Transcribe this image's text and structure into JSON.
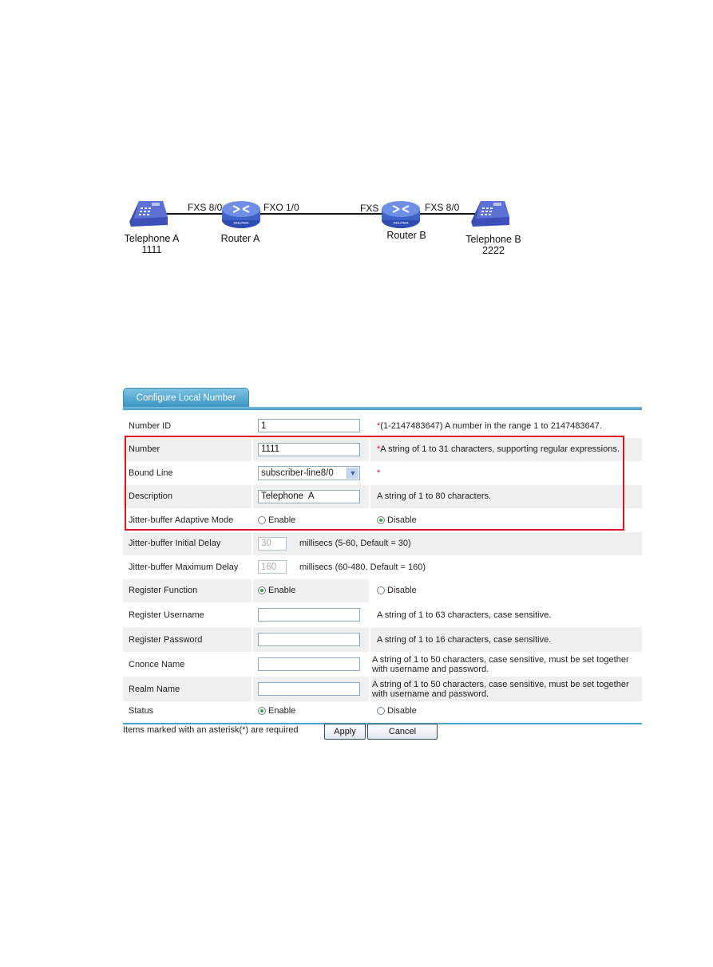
{
  "diagram": {
    "devices": [
      {
        "id": "telephone-a",
        "name": "Telephone A",
        "number": "1111"
      },
      {
        "id": "router-a",
        "name": "Router A",
        "badge": "ROUTER"
      },
      {
        "id": "router-b",
        "name": "Router B",
        "badge": "ROUTER"
      },
      {
        "id": "telephone-b",
        "name": "Telephone B",
        "number": "2222"
      }
    ],
    "ports": {
      "router_a_left": "FXS 8/0",
      "router_a_right": "FXO  1/0",
      "router_b_left": "FXS",
      "router_b_right": "FXS 8/0"
    }
  },
  "form": {
    "tab_label": "Configure Local Number",
    "required_mark": "*",
    "rows": {
      "number_id": {
        "label": "Number ID",
        "value": "1",
        "hint": "(1-2147483647) A number in the range 1 to 2147483647."
      },
      "number": {
        "label": "Number",
        "value": "1111",
        "hint": "A string of 1 to 31 characters, supporting regular expressions."
      },
      "bound_line": {
        "label": "Bound Line",
        "value": "subscriber-line8/0",
        "hint": ""
      },
      "description": {
        "label": "Description",
        "value": "Telephone  A",
        "hint": "A string of 1 to 80 characters."
      },
      "jitter_adaptive": {
        "label": "Jitter-buffer Adaptive Mode",
        "options": [
          "Enable",
          "Disable"
        ],
        "selected": "Disable"
      },
      "jitter_initial": {
        "label": "Jitter-buffer Initial Delay",
        "value": "30",
        "hint": "millisecs (5-60, Default = 30)"
      },
      "jitter_max": {
        "label": "Jitter-buffer Maximum Delay",
        "value": "160",
        "hint": "millisecs (60-480, Default = 160)"
      },
      "register_function": {
        "label": "Register Function",
        "options": [
          "Enable",
          "Disable"
        ],
        "selected": "Enable"
      },
      "register_username": {
        "label": "Register Username",
        "value": "",
        "hint": "A string of 1 to 63 characters, case sensitive."
      },
      "register_password": {
        "label": "Register Password",
        "value": "",
        "hint": "A string of 1 to 16 characters, case sensitive."
      },
      "cnonce_name": {
        "label": "Cnonce Name",
        "value": "",
        "hint": " A string of 1 to 50 characters, case sensitive, must be set together with username and password."
      },
      "realm_name": {
        "label": "Realm Name",
        "value": "",
        "hint": " A string of 1 to 50 characters, case sensitive, must be set together with username and password."
      },
      "status": {
        "label": "Status",
        "options": [
          "Enable",
          "Disable"
        ],
        "selected": "Enable"
      }
    },
    "note": "Items marked with an asterisk(*) are required",
    "buttons": {
      "apply": "Apply",
      "cancel": "Cancel"
    },
    "colors": {
      "tab": "#3a94c2",
      "highlight_border": "#e0141e",
      "required": "#d0112b",
      "radio_selected": "#2aa83a"
    }
  }
}
